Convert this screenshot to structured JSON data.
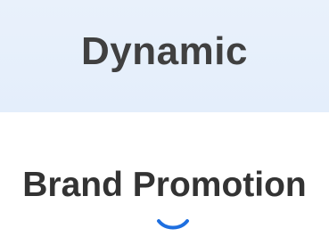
{
  "top_section": {
    "title": "Dynamic"
  },
  "bottom_section": {
    "title": "Brand Promotion",
    "icon": "smile-icon",
    "accent_color": "#1e6fe0"
  }
}
